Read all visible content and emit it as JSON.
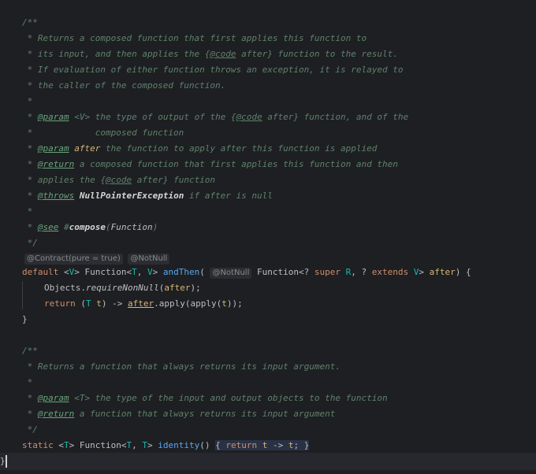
{
  "editor": {
    "lines": [
      "/**",
      " * Returns a composed function that first applies this function to",
      " * its input, and then applies the {",
      "@code",
      " after} function to the result.",
      " * If evaluation of either function throws an exception, it is relayed to",
      " * the caller of the composed function.",
      " *",
      "@param",
      "<V>",
      " the type of output of the {",
      " after} function, and of the",
      " *            composed function",
      "after",
      " the function to apply after this function is applied",
      "@return",
      " a composed function that first applies this function and then",
      " * applies the {",
      "@throws",
      "NullPointerException",
      " if after is null",
      "@see",
      "#",
      "compose",
      "Function",
      " */",
      "@Contract(pure = true)",
      "@NotNull",
      "default",
      "Function",
      "T",
      "V",
      "andThen",
      "? ",
      "super",
      "R",
      "extends",
      "Objects",
      "requireNonNull",
      "return",
      "apply",
      "t",
      " * Returns a function that always returns its input argument.",
      "<T>",
      " the type of the input and output objects to the function",
      " a function that always returns its input argument",
      "static",
      "identity",
      "}"
    ]
  },
  "colors": {
    "background": "#1e1f22",
    "keyword": "#cf8e6d",
    "doc_comment": "#5f826b",
    "type_param": "#16baac",
    "function_name": "#56a8f5",
    "parameter": "#d5b778"
  }
}
